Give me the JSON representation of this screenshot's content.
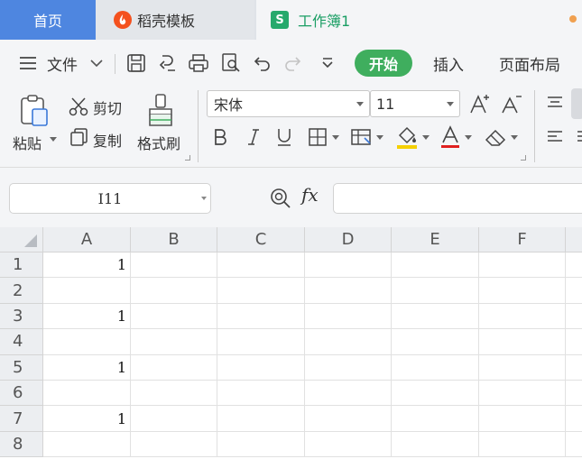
{
  "tabs": {
    "home": "首页",
    "template": "稻壳模板",
    "workbook": "工作簿1",
    "workbook_badge": "S"
  },
  "menu": {
    "file_label": "文件",
    "start": "开始",
    "insert": "插入",
    "page_layout": "页面布局"
  },
  "ribbon": {
    "paste": "粘贴",
    "cut": "剪切",
    "copy": "复制",
    "format_painter": "格式刷",
    "font_name": "宋体",
    "font_size": "11"
  },
  "formula_bar": {
    "name_box": "I11",
    "fx_label": "fx",
    "formula_value": ""
  },
  "sheet": {
    "columns": [
      "A",
      "B",
      "C",
      "D",
      "E",
      "F"
    ],
    "rows": [
      "1",
      "2",
      "3",
      "4",
      "5",
      "6",
      "7",
      "8"
    ],
    "cells": [
      [
        "1",
        "",
        "",
        "",
        "",
        ""
      ],
      [
        "",
        "",
        "",
        "",
        "",
        ""
      ],
      [
        "1",
        "",
        "",
        "",
        "",
        ""
      ],
      [
        "",
        "",
        "",
        "",
        "",
        ""
      ],
      [
        "1",
        "",
        "",
        "",
        "",
        ""
      ],
      [
        "",
        "",
        "",
        "",
        "",
        ""
      ],
      [
        "1",
        "",
        "",
        "",
        "",
        ""
      ],
      [
        "",
        "",
        "",
        "",
        "",
        ""
      ]
    ]
  },
  "colors": {
    "home_tab": "#4e86e0",
    "accent_green": "#3fae5e",
    "font_color_underline": "#e02020",
    "highlight_yellow": "#f5d000"
  }
}
